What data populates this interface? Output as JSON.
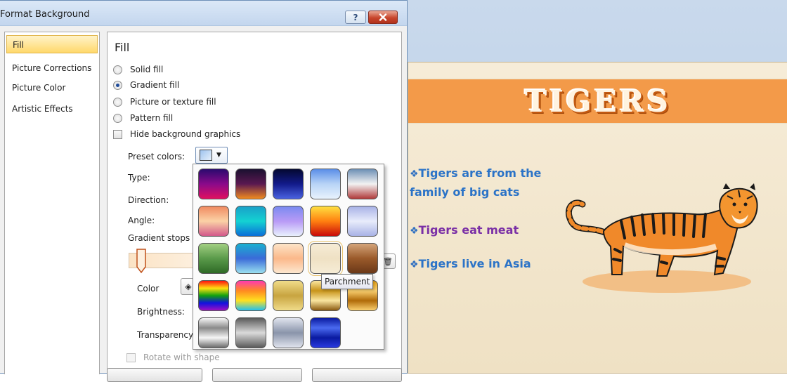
{
  "dialog": {
    "title": "Format Background",
    "help_label": "?",
    "nav": [
      "Fill",
      "Picture Corrections",
      "Picture Color",
      "Artistic Effects"
    ],
    "panel_heading": "Fill",
    "fill_options": [
      "Solid fill",
      "Gradient fill",
      "Picture or texture fill",
      "Pattern fill"
    ],
    "selected_fill": "Gradient fill",
    "hide_background_graphics": "Hide background graphics",
    "preset_colors_label": "Preset colors:",
    "type_label": "Type:",
    "direction_label": "Direction:",
    "angle_label": "Angle:",
    "gradient_stops_label": "Gradient stops",
    "color_label": "Color",
    "brightness_label": "Brightness:",
    "transparency_label": "Transparency",
    "rotate_with_shape": "Rotate with shape"
  },
  "preset_popup": {
    "tooltip": "Parchment",
    "selected_index": 13,
    "swatches": [
      {
        "name": "preset-1",
        "colors": [
          "#2a0a6e",
          "#8a0a8a",
          "#e01060"
        ]
      },
      {
        "name": "preset-2",
        "colors": [
          "#1a1030",
          "#5a1850",
          "#f08a20"
        ]
      },
      {
        "name": "preset-3",
        "colors": [
          "#040830",
          "#121a8a",
          "#4a62e0"
        ]
      },
      {
        "name": "preset-4",
        "colors": [
          "#5a8ee8",
          "#b8d4f6",
          "#e8f2fd"
        ]
      },
      {
        "name": "preset-5",
        "colors": [
          "#6d8fb5",
          "#f2f2f2",
          "#b03a3a"
        ]
      },
      {
        "name": "preset-6",
        "colors": [
          "#f08a60",
          "#fbd2a6",
          "#d2588a"
        ]
      },
      {
        "name": "preset-7",
        "colors": [
          "#1aa0c8",
          "#14d2d2",
          "#0a6ed8"
        ]
      },
      {
        "name": "preset-8",
        "colors": [
          "#7a8af0",
          "#b89af6",
          "#e8f0fd"
        ]
      },
      {
        "name": "preset-9",
        "colors": [
          "#ffe040",
          "#ff8010",
          "#c80a0a"
        ]
      },
      {
        "name": "preset-10",
        "colors": [
          "#a8b2e6",
          "#e8ecfb",
          "#a8b2e6"
        ]
      },
      {
        "name": "preset-11",
        "colors": [
          "#a2cf82",
          "#5a9a4a",
          "#2e6a26"
        ]
      },
      {
        "name": "preset-12",
        "colors": [
          "#1ab0d0",
          "#3a6ad8",
          "#9ae0f0"
        ]
      },
      {
        "name": "preset-13",
        "colors": [
          "#fce4c8",
          "#fbb88a",
          "#fde8d0"
        ]
      },
      {
        "name": "preset-14",
        "colors": [
          "#f6ecd6",
          "#efe1c4",
          "#f6ecd6"
        ]
      },
      {
        "name": "preset-15",
        "colors": [
          "#d4a47a",
          "#9a5a2a",
          "#6a3818"
        ]
      },
      {
        "name": "preset-16",
        "colors": [
          "#ff1010",
          "#ffe010",
          "#10a010",
          "#1010e0",
          "#a010c0"
        ]
      },
      {
        "name": "preset-17",
        "colors": [
          "#ff3ab0",
          "#ff8a20",
          "#ffe020",
          "#20c0f0"
        ]
      },
      {
        "name": "preset-18",
        "colors": [
          "#f0dc8a",
          "#c8a440",
          "#f0dc8a"
        ]
      },
      {
        "name": "preset-19",
        "colors": [
          "#fae6a0",
          "#c8941a",
          "#fae6a0",
          "#8a5a10"
        ]
      },
      {
        "name": "preset-20",
        "colors": [
          "#e8a010",
          "#fad070",
          "#b06a08",
          "#fad070"
        ]
      },
      {
        "name": "preset-21",
        "colors": [
          "#f6f6f6",
          "#8a8a8a",
          "#f6f6f6",
          "#6a6a6a"
        ]
      },
      {
        "name": "preset-22",
        "colors": [
          "#5a5a5a",
          "#dadada",
          "#5a5a5a"
        ]
      },
      {
        "name": "preset-23",
        "colors": [
          "#e0e4ee",
          "#8a94aa",
          "#e0e4ee"
        ]
      },
      {
        "name": "preset-24",
        "colors": [
          "#0a1aa0",
          "#4a6af0",
          "#0a1aa0",
          "#2a3ae0"
        ]
      }
    ]
  },
  "slide": {
    "title": "TIGERS",
    "bullets": [
      "Tigers are from the family of big cats",
      "Tigers eat meat",
      "Tigers live in Asia"
    ],
    "bullet_mark": "❖",
    "colors": {
      "title_band": "#f39a49",
      "bullet_blue": "#2b73c7",
      "bullet_purple": "#7a2fa6",
      "background": "#f3e7cf"
    }
  }
}
